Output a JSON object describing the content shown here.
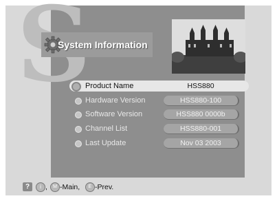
{
  "header": {
    "title": "System Information"
  },
  "rows": [
    {
      "label": "Product Name",
      "value": "HSS880"
    },
    {
      "label": "Hardware Version",
      "value": "HSS880-100"
    },
    {
      "label": "Software Version",
      "value": "HSS880 0000b"
    },
    {
      "label": "Channel List",
      "value": "HSS880-001"
    },
    {
      "label": "Last Update",
      "value": "Nov 03 2003"
    }
  ],
  "footer": {
    "help": "?",
    "key_info": "i",
    "sep": ",",
    "key_main": "M",
    "main_text": "-Main,",
    "key_prev": "E",
    "prev_text": "-Prev."
  }
}
